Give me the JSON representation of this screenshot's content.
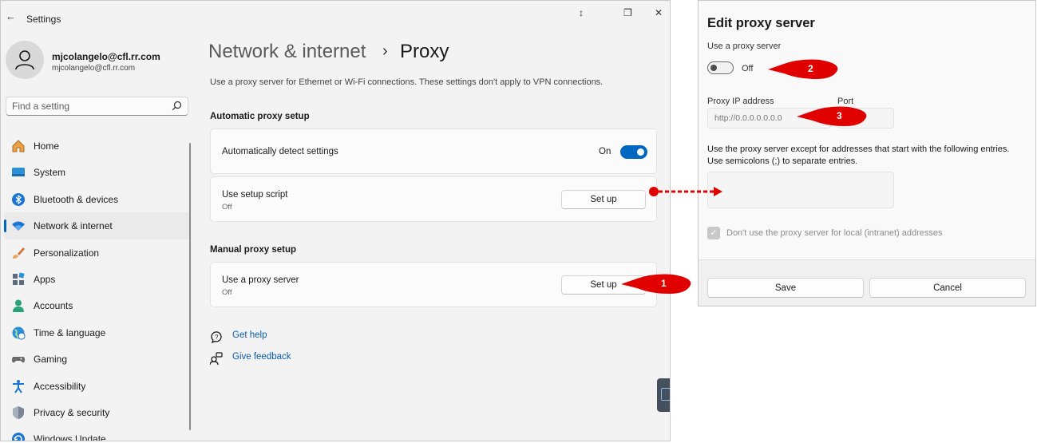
{
  "window": {
    "title": "Settings",
    "back_glyph": "←",
    "controls": {
      "extra": "↕",
      "restore": "❐",
      "close": "✕"
    }
  },
  "account": {
    "name": "mjcolangelo@cfl.rr.com",
    "email": "mjcolangelo@cfl.rr.com"
  },
  "search": {
    "placeholder": "Find a setting",
    "icon": "search-icon"
  },
  "sidebar": {
    "items": [
      {
        "label": "Home",
        "icon": "home-icon"
      },
      {
        "label": "System",
        "icon": "system-icon"
      },
      {
        "label": "Bluetooth & devices",
        "icon": "bluetooth-icon"
      },
      {
        "label": "Network & internet",
        "icon": "wifi-icon",
        "active": true
      },
      {
        "label": "Personalization",
        "icon": "brush-icon"
      },
      {
        "label": "Apps",
        "icon": "apps-icon"
      },
      {
        "label": "Accounts",
        "icon": "accounts-icon"
      },
      {
        "label": "Time & language",
        "icon": "globe-icon"
      },
      {
        "label": "Gaming",
        "icon": "gamepad-icon"
      },
      {
        "label": "Accessibility",
        "icon": "accessibility-icon"
      },
      {
        "label": "Privacy & security",
        "icon": "shield-icon"
      },
      {
        "label": "Windows Update",
        "icon": "update-icon"
      }
    ]
  },
  "page": {
    "breadcrumb_parent": "Network & internet",
    "breadcrumb_sep": "›",
    "title": "Proxy",
    "description": "Use a proxy server for Ethernet or Wi-Fi connections. These settings don't apply to VPN connections."
  },
  "automatic": {
    "heading": "Automatic proxy setup",
    "detect": {
      "label": "Automatically detect settings",
      "state_label": "On",
      "enabled": true
    },
    "script": {
      "label": "Use setup script",
      "status": "Off",
      "button": "Set up"
    }
  },
  "manual": {
    "heading": "Manual proxy setup",
    "proxy": {
      "label": "Use a proxy server",
      "status": "Off",
      "button": "Set up"
    }
  },
  "links": {
    "help": "Get help",
    "feedback": "Give feedback"
  },
  "dialog": {
    "title": "Edit proxy server",
    "use_proxy_label": "Use a proxy server",
    "toggle_state": "Off",
    "ip_label": "Proxy IP address",
    "ip_placeholder": "http://0.0.0.0.0.0.0",
    "port_label": "Port",
    "exceptions_text_1": "Use the proxy server except for addresses that start with the following entries.",
    "exceptions_text_2": "Use semicolons (;) to separate entries.",
    "local_checkbox_label": "Don't use the proxy server for local (intranet) addresses",
    "local_checked": true,
    "save": "Save",
    "cancel": "Cancel"
  },
  "annotations": {
    "c1": "1",
    "c2": "2",
    "c3": "3"
  },
  "colors": {
    "accent": "#0067c0",
    "callout": "#e00000",
    "link": "#0b5cad"
  }
}
